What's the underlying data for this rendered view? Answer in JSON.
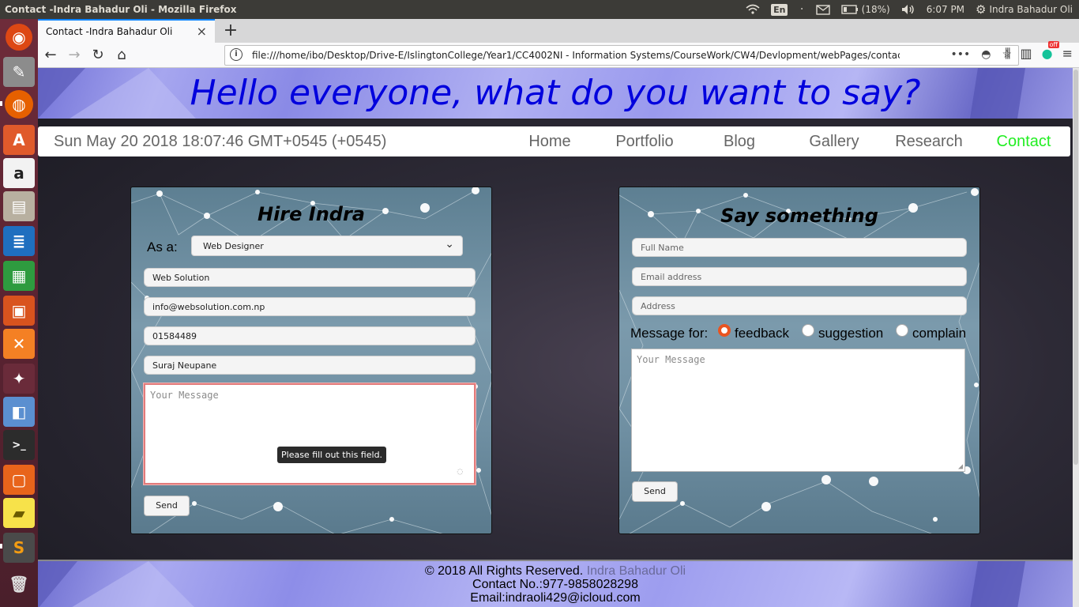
{
  "system": {
    "window_title": "Contact -Indra Bahadur Oli - Mozilla Firefox",
    "keyboard": "En",
    "battery": "(18%)",
    "clock": "6:07 PM",
    "user": "Indra Bahadur Oli"
  },
  "browser": {
    "tab_title": "Contact -Indra Bahadur Oli",
    "url": "file:///home/ibo/Desktop/Drive-E/IslingtonCollege/Year1/CC4002NI - Information Systems/CourseWork/CW4/Devlopment/webPages/contact.html?employee=programm",
    "addon_badge": "off"
  },
  "page": {
    "hero_title": "Hello everyone, what do you want to say?",
    "datetime": "Sun May 20 2018 18:07:46 GMT+0545 (+0545)",
    "nav": [
      "Home",
      "Portfolio",
      "Blog",
      "Gallery",
      "Research",
      "Contact"
    ],
    "hire": {
      "title": "Hire Indra",
      "as_label": "As a:",
      "role_selected": "Web Designer",
      "company": "Web Solution",
      "email": "info@websolution.com.np",
      "phone": "01584489",
      "name": "Suraj Neupane",
      "message_placeholder": "Your Message",
      "tooltip": "Please fill out this field.",
      "send": "Send"
    },
    "say": {
      "title": "Say something",
      "fullname_placeholder": "Full Name",
      "email_placeholder": "Email address",
      "address_placeholder": "Address",
      "message_for_label": "Message for:",
      "options": [
        "feedback",
        "suggestion",
        "complain"
      ],
      "selected_option": "feedback",
      "message_placeholder": "Your Message",
      "send": "Send"
    },
    "footer": {
      "copyright": "© 2018 All Rights Reserved.",
      "author": "Indra Bahadur Oli",
      "contact": "Contact No.:977-9858028298",
      "email": "Email:indraoli429@icloud.com"
    }
  }
}
